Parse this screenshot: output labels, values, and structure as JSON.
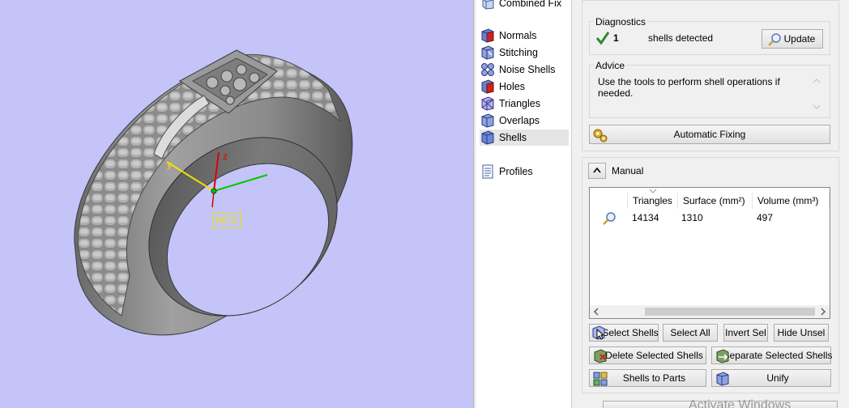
{
  "viewport": {
    "wcs_label": "WCS",
    "axis_z": "z",
    "axis_y": "y",
    "background": "#c4c4f9"
  },
  "tree": {
    "items": [
      {
        "label": "Combined Fix",
        "icon": "combined-fix-icon"
      },
      {
        "label": "Normals",
        "icon": "normals-icon"
      },
      {
        "label": "Stitching",
        "icon": "stitching-icon"
      },
      {
        "label": "Noise Shells",
        "icon": "noise-shells-icon"
      },
      {
        "label": "Holes",
        "icon": "holes-icon"
      },
      {
        "label": "Triangles",
        "icon": "triangles-icon"
      },
      {
        "label": "Overlaps",
        "icon": "overlaps-icon"
      },
      {
        "label": "Shells",
        "icon": "shells-icon",
        "selected": true
      },
      {
        "label": "Profiles",
        "icon": "profiles-icon"
      }
    ]
  },
  "diagnostics": {
    "title": "Diagnostics",
    "count": "1",
    "status_text": "shells detected",
    "update_label": "Update"
  },
  "advice": {
    "title": "Advice",
    "text": "Use the tools to perform shell operations if needed."
  },
  "automatic_fixing_label": "Automatic Fixing",
  "manual": {
    "title": "Manual",
    "table": {
      "headers": [
        "Triangles",
        "Surface (mm²)",
        "Volume (mm³)"
      ],
      "rows": [
        {
          "triangles": "14134",
          "surface": "1310",
          "volume": "497"
        }
      ]
    },
    "buttons": {
      "select_shells": "Select Shells",
      "select_all": "Select All",
      "invert_sel": "Invert Sel",
      "hide_unsel": "Hide Unsel",
      "delete_selected": "Delete Selected Shells",
      "separate_selected": "Separate Selected Shells",
      "shells_to_parts": "Shells to Parts",
      "unify": "Unify"
    }
  },
  "watermark": "Activate Windows",
  "colors": {
    "accent_green": "#2e8b2e",
    "selection": "#e5e5e5",
    "axis_z": "#e00000",
    "axis_x": "#00c800",
    "axis_y": "#f0e000"
  }
}
